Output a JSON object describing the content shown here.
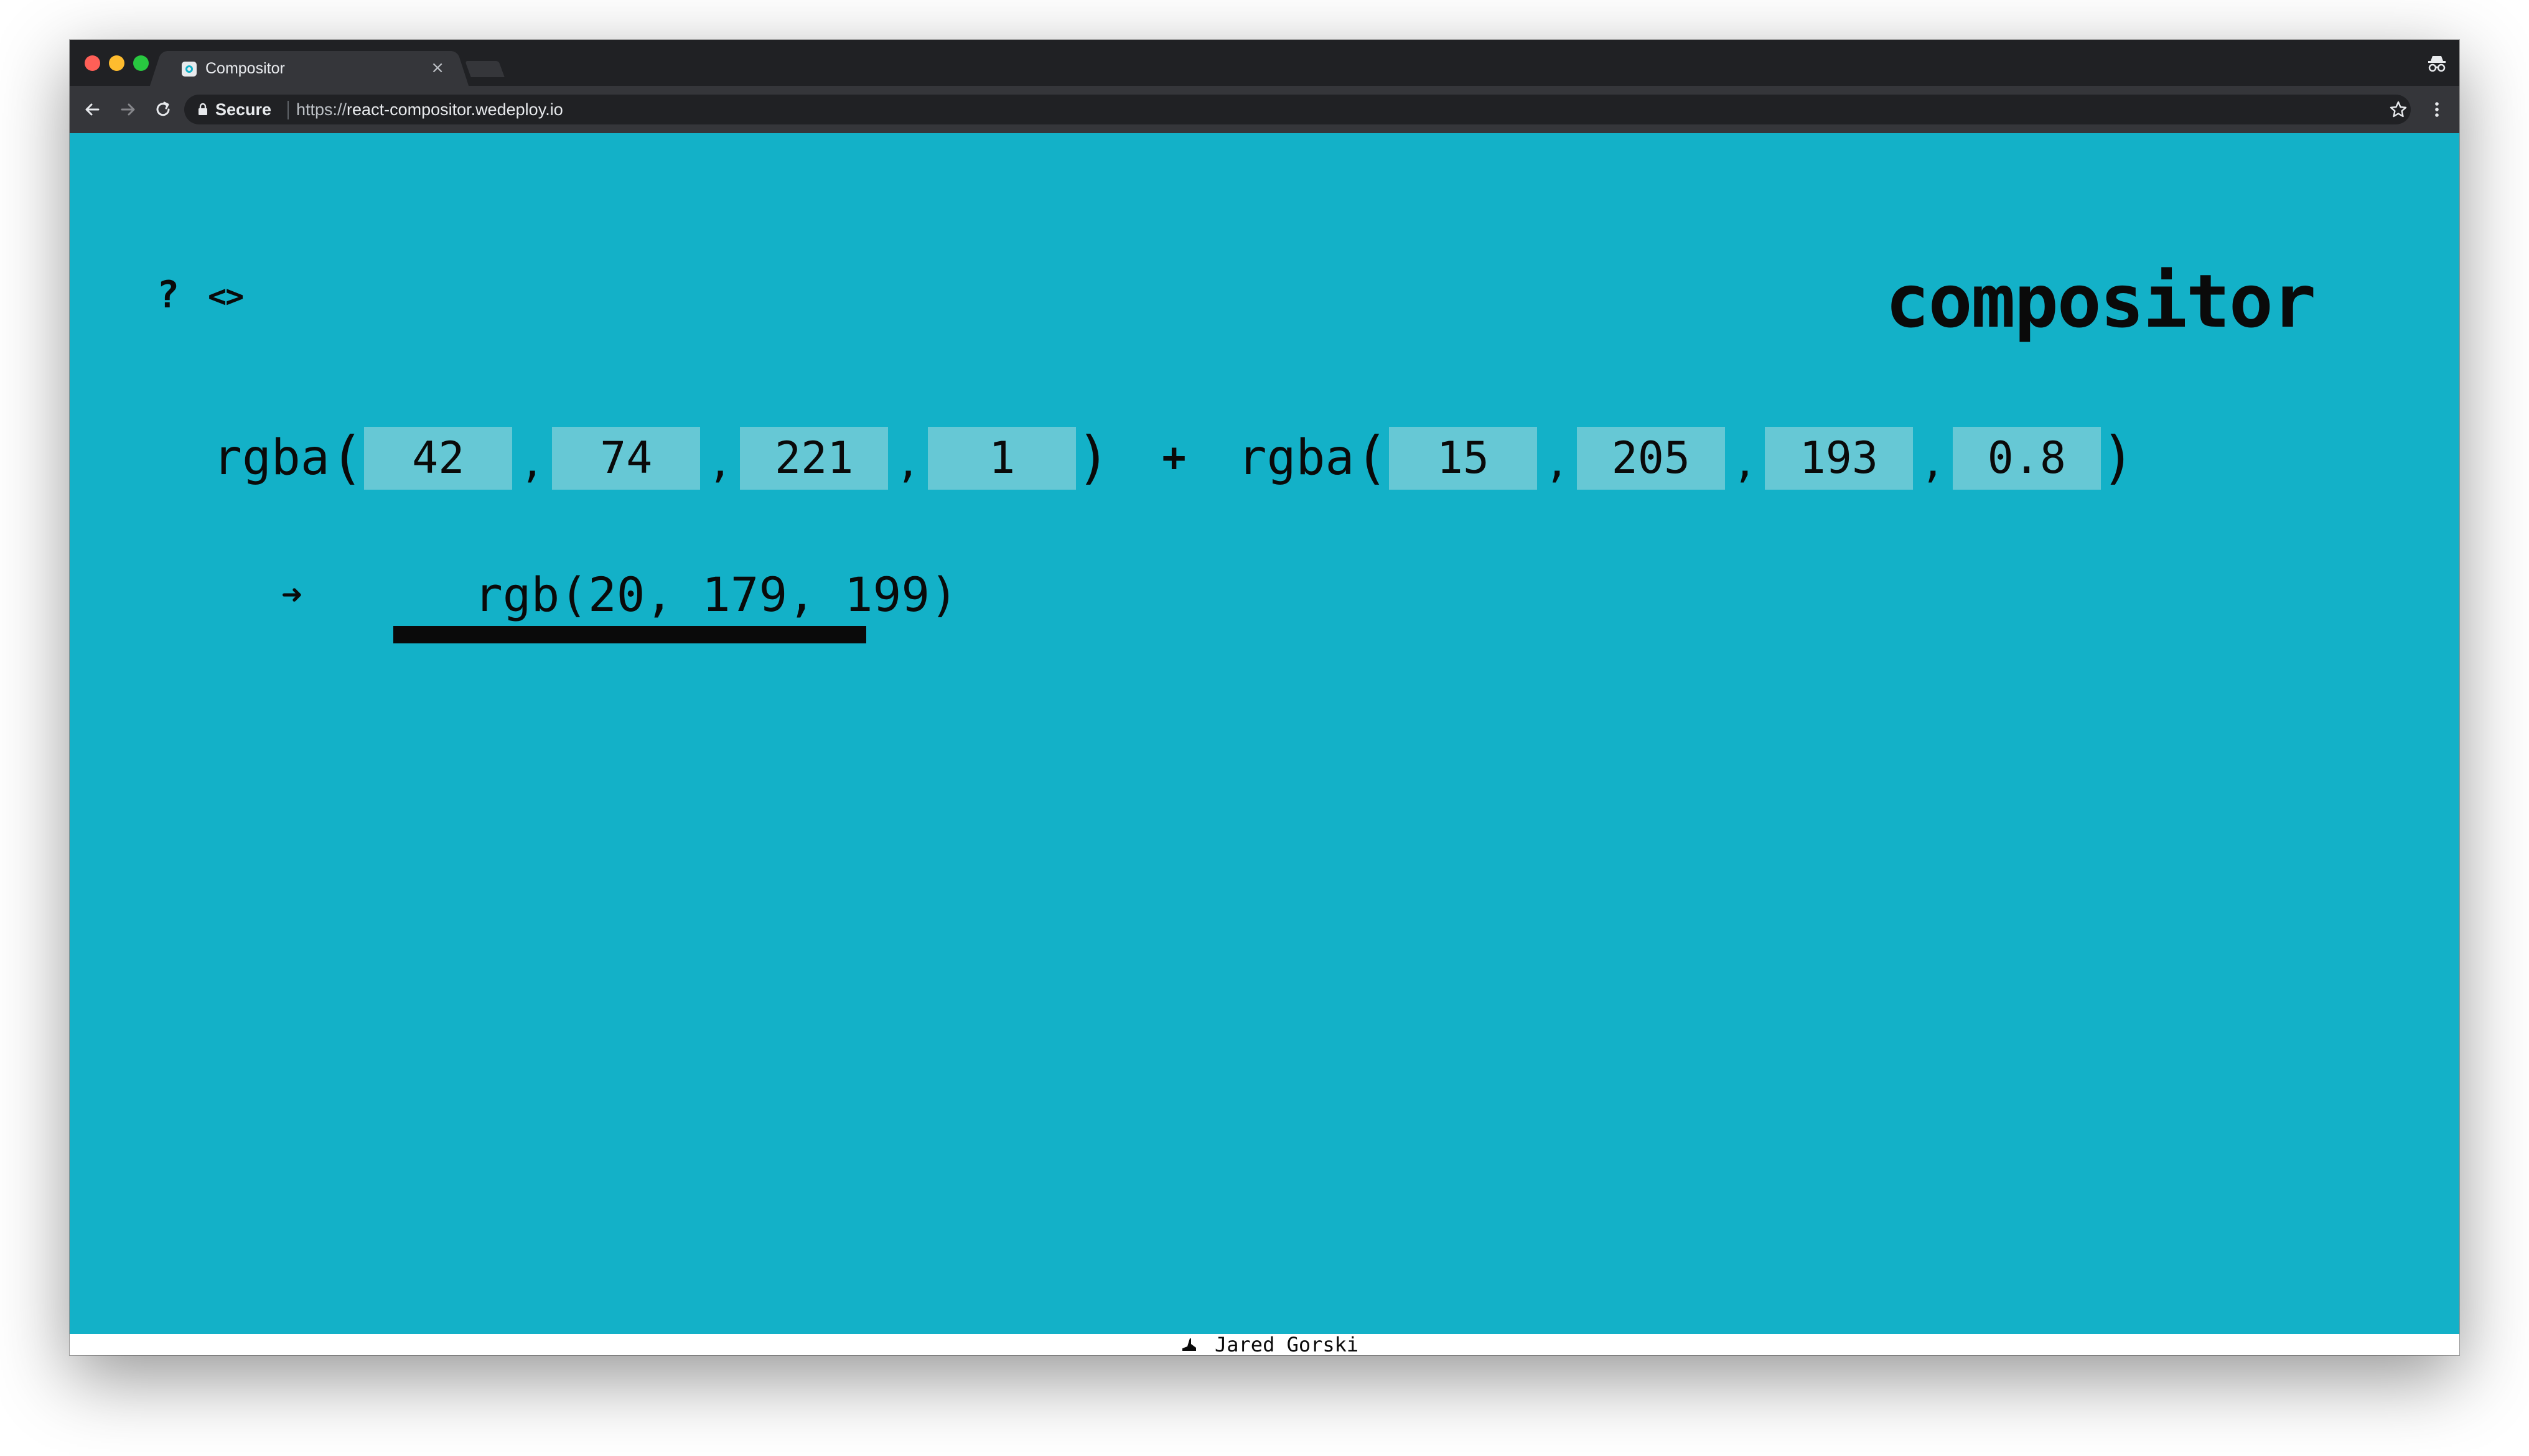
{
  "browser": {
    "tab": {
      "title": "Compositor",
      "close_glyph": "×",
      "favicon": "compositor-favicon"
    },
    "address_bar": {
      "secure_label": "Secure",
      "url_scheme": "https://",
      "url_host": "react-compositor.wedeploy.io"
    },
    "icons": {
      "back": "back-arrow-icon",
      "forward": "forward-arrow-icon",
      "reload": "reload-icon",
      "lock": "lock-icon",
      "bookmark": "star-icon",
      "menu": "kebab-menu-icon",
      "incognito": "incognito-icon"
    }
  },
  "page": {
    "background_color": "#13b1c8",
    "input_color": "#66c8d5",
    "text_color": "#0a0a0a",
    "header": {
      "help_label": "?",
      "source_label": "<>",
      "brand": "compositor"
    },
    "formula": {
      "fn_name": "rgba",
      "open_paren": "(",
      "close_paren": ")",
      "separator": ",",
      "operator": "+",
      "color_a": {
        "r": "42",
        "g": "74",
        "b": "221",
        "a": "1"
      },
      "color_b": {
        "r": "15",
        "g": "205",
        "b": "193",
        "a": "0.8"
      }
    },
    "result": {
      "arrow": "➜",
      "value": "rgb(20, 179, 199)"
    }
  },
  "footer": {
    "author": "Jared Gorski",
    "icon": "shoe-icon"
  }
}
